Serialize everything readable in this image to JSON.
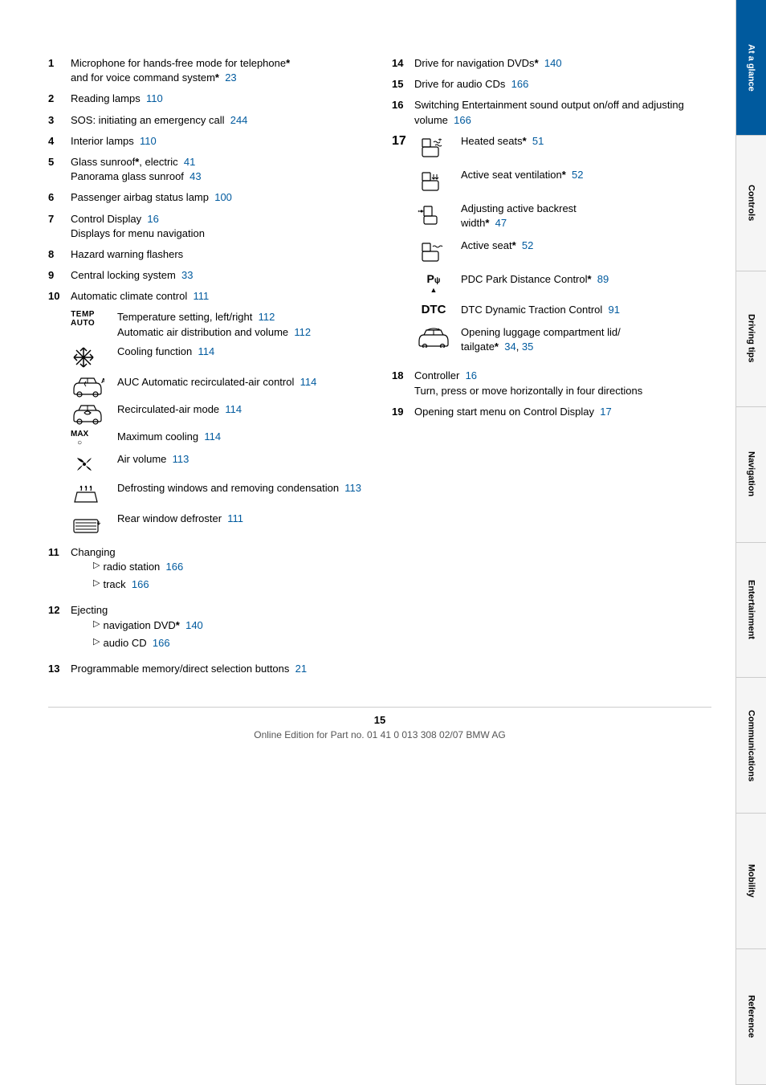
{
  "page": {
    "number": "15",
    "footer": "Online Edition for Part no. 01 41 0 013 308 02/07 BMW AG"
  },
  "sidebar": {
    "tabs": [
      {
        "id": "at-a-glance",
        "label": "At a glance",
        "active": true
      },
      {
        "id": "controls",
        "label": "Controls",
        "active": false
      },
      {
        "id": "driving-tips",
        "label": "Driving tips",
        "active": false
      },
      {
        "id": "navigation",
        "label": "Navigation",
        "active": false
      },
      {
        "id": "entertainment",
        "label": "Entertainment",
        "active": false
      },
      {
        "id": "communications",
        "label": "Communications",
        "active": false
      },
      {
        "id": "mobility",
        "label": "Mobility",
        "active": false
      },
      {
        "id": "reference",
        "label": "Reference",
        "active": false
      }
    ]
  },
  "left_col": {
    "items": [
      {
        "num": "1",
        "text": "Microphone for hands-free mode for telephone",
        "star": true,
        "continuation": "and for voice command system",
        "continuation_star": true,
        "continuation_ref": "23"
      },
      {
        "num": "2",
        "text": "Reading lamps",
        "ref": "110"
      },
      {
        "num": "3",
        "text": "SOS: initiating an emergency call",
        "ref": "244"
      },
      {
        "num": "4",
        "text": "Interior lamps",
        "ref": "110"
      },
      {
        "num": "5",
        "text": "Glass sunroof",
        "star": true,
        "extra": ", electric",
        "ref": "41",
        "sub": "Panorama glass sunroof",
        "sub_ref": "43"
      },
      {
        "num": "6",
        "text": "Passenger airbag status lamp",
        "ref": "100"
      },
      {
        "num": "7",
        "text": "Control Display",
        "ref": "16",
        "sub": "Displays for menu navigation"
      },
      {
        "num": "8",
        "text": "Hazard warning flashers"
      },
      {
        "num": "9",
        "text": "Central locking system",
        "ref": "33"
      },
      {
        "num": "10",
        "text": "Automatic climate control",
        "ref": "111"
      }
    ],
    "climate_items": [
      {
        "icon_type": "temp_auto",
        "label_top": "TEMP",
        "label_bottom": "AUTO",
        "text_lines": [
          {
            "text": "Temperature setting, left/right",
            "ref": "112"
          },
          {
            "text": "Automatic air distribution and volume",
            "ref": "112"
          }
        ]
      },
      {
        "icon_type": "snowflake",
        "text": "Cooling function",
        "ref": "114"
      },
      {
        "icon_type": "auc",
        "text": "AUC Automatic recirculated-air control",
        "ref": "114"
      },
      {
        "icon_type": "recirculate",
        "text": "Recirculated-air mode",
        "ref": "114"
      },
      {
        "icon_type": "max_o",
        "label": "MAX\n○",
        "text": "Maximum cooling",
        "ref": "114"
      },
      {
        "icon_type": "fan",
        "text": "Air volume",
        "ref": "113"
      },
      {
        "icon_type": "defrost_front",
        "text": "Defrosting windows and removing condensation",
        "ref": "113"
      },
      {
        "icon_type": "defrost_rear",
        "text": "Rear window defroster",
        "ref": "111"
      }
    ],
    "items_11_plus": [
      {
        "num": "11",
        "text": "Changing",
        "subs": [
          {
            "text": "radio station",
            "ref": "166"
          },
          {
            "text": "track",
            "ref": "166"
          }
        ]
      },
      {
        "num": "12",
        "text": "Ejecting",
        "subs": [
          {
            "text": "navigation DVD",
            "star": true,
            "ref": "140"
          },
          {
            "text": "audio CD",
            "ref": "166"
          }
        ]
      },
      {
        "num": "13",
        "text": "Programmable memory/direct selection buttons",
        "ref": "21"
      }
    ]
  },
  "right_col": {
    "items_14_16": [
      {
        "num": "14",
        "text": "Drive for navigation DVDs",
        "star": true,
        "ref": "140"
      },
      {
        "num": "15",
        "text": "Drive for audio CDs",
        "ref": "166"
      },
      {
        "num": "16",
        "text": "Switching Entertainment sound output on/off and adjusting volume",
        "ref": "166"
      }
    ],
    "item_17": {
      "num": "17",
      "icon_items": [
        {
          "icon_type": "heated_seat",
          "text": "Heated seats",
          "star": true,
          "ref": "51"
        },
        {
          "icon_type": "seat_ventilation",
          "text": "Active seat ventilation",
          "star": true,
          "ref": "52"
        },
        {
          "icon_type": "backrest",
          "text": "Adjusting active backrest width",
          "star": true,
          "ref": "47"
        },
        {
          "icon_type": "active_seat",
          "text": "Active seat",
          "star": true,
          "ref": "52"
        },
        {
          "icon_type": "pdc",
          "text": "PDC Park Distance Control",
          "star": true,
          "ref": "89"
        },
        {
          "icon_type": "dtc",
          "text": "DTC Dynamic Traction Control",
          "ref": "91"
        },
        {
          "icon_type": "luggage",
          "text": "Opening luggage compartment lid/tailgate",
          "star": true,
          "ref1": "34",
          "ref2": "35"
        }
      ]
    },
    "items_18_19": [
      {
        "num": "18",
        "text": "Controller",
        "ref": "16",
        "sub": "Turn, press or move horizontally in four directions"
      },
      {
        "num": "19",
        "text": "Opening start menu on Control Display",
        "ref": "17"
      }
    ]
  }
}
